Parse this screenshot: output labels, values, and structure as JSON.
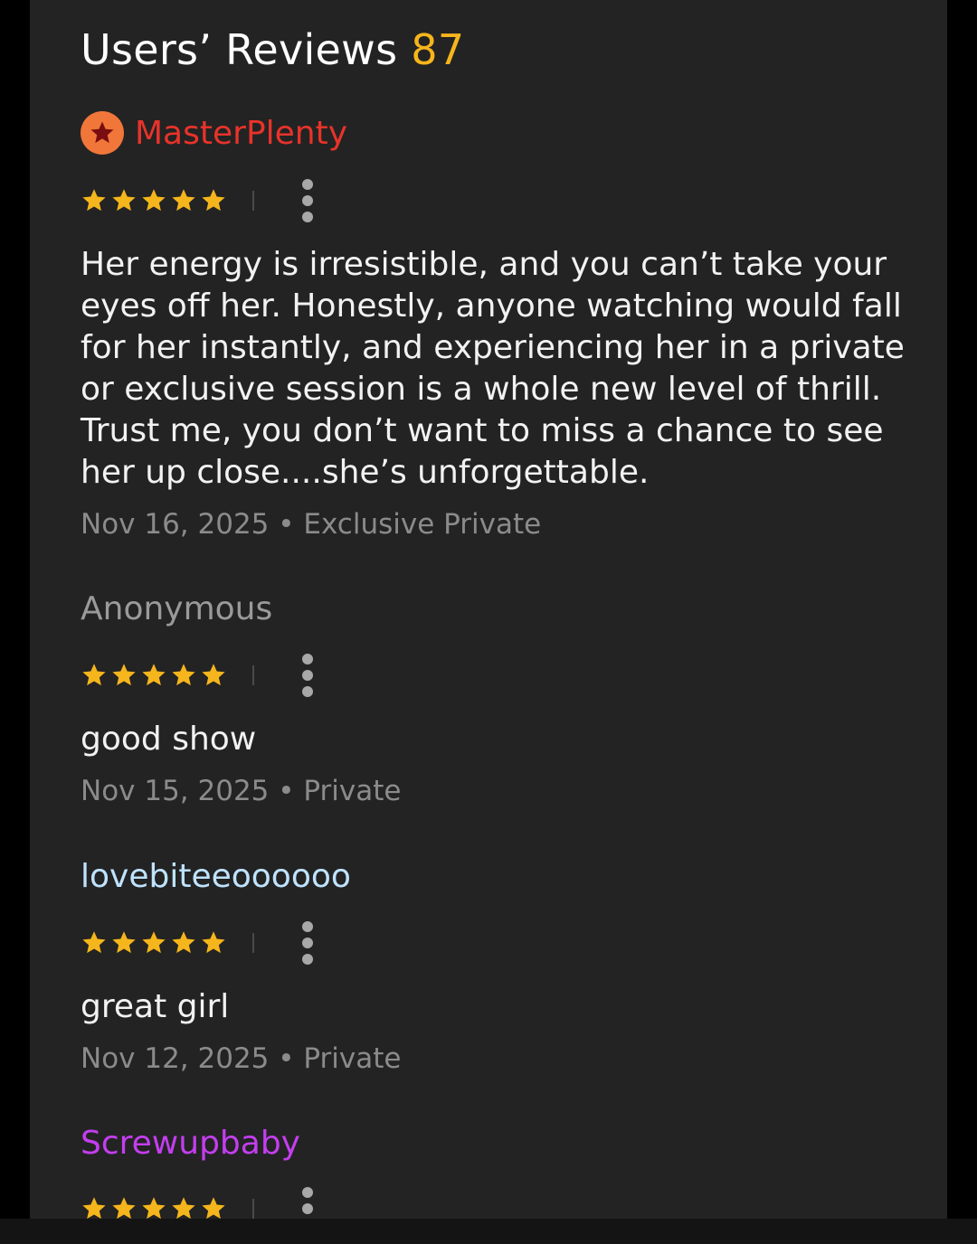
{
  "header": {
    "title": "Users’ Reviews",
    "count": "87"
  },
  "colors": {
    "accent": "#f5b51c",
    "star": "#f5b51c",
    "badge": "#f0763a"
  },
  "reviews": [
    {
      "username": "MasterPlenty",
      "username_color": "#e8332a",
      "badge_icon": "star-badge-icon",
      "rating": 5,
      "text": "Her energy is irresistible, and you can’t take your eyes off her. Honestly, anyone watching would fall for her instantly, and experiencing her in a private or exclusive session is a whole new level of thrill. Trust me, you don’t want to miss a chance to see her up close....she’s unforgettable.",
      "date": "Nov 16, 2025",
      "type": "Exclusive Private"
    },
    {
      "username": "Anonymous",
      "username_color": "#9a9a9a",
      "rating": 5,
      "text": "good show",
      "date": "Nov 15, 2025",
      "type": "Private"
    },
    {
      "username": "lovebiteeoooooo",
      "username_color": "#bfe3ff",
      "rating": 5,
      "text": "great girl",
      "date": "Nov 12, 2025",
      "type": "Private"
    },
    {
      "username": "Screwupbaby",
      "username_color": "#c43ef0",
      "rating": 5
    }
  ]
}
